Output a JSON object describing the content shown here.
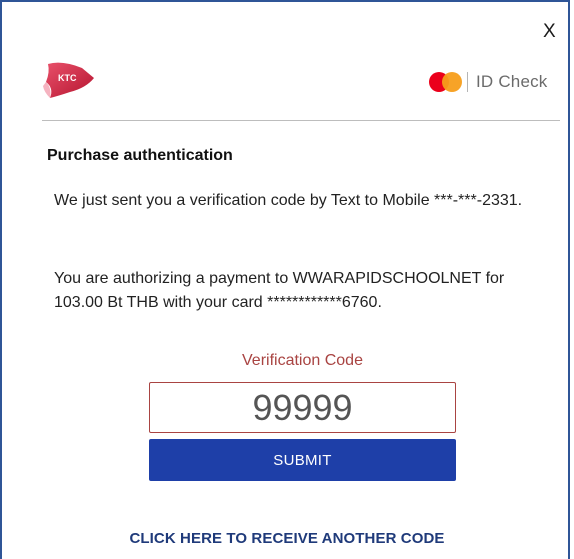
{
  "dialog": {
    "close_label": "X"
  },
  "header": {
    "bank_logo_text": "KTC",
    "id_check_label": "ID Check",
    "icons": [
      "ktc-logo",
      "mastercard-icon"
    ]
  },
  "content": {
    "title": "Purchase authentication",
    "message_sent": "We just sent you a verification code by Text to Mobile ***-***-2331.",
    "message_authorizing": "You are authorizing a payment to WWARAPIDSCHOOLNET for 103.00 Bt THB with your card ************6760."
  },
  "form": {
    "code_label": "Verification Code",
    "code_value": "99999",
    "submit_label": "SUBMIT",
    "resend_label": "CLICK HERE TO RECEIVE ANOTHER CODE"
  },
  "colors": {
    "frame_border": "#2f5597",
    "submit_bg": "#1e3fa8",
    "label_red": "#a94442",
    "link_blue": "#1f3a7a",
    "mc_red": "#eb001b",
    "mc_orange": "#f79e1b"
  }
}
